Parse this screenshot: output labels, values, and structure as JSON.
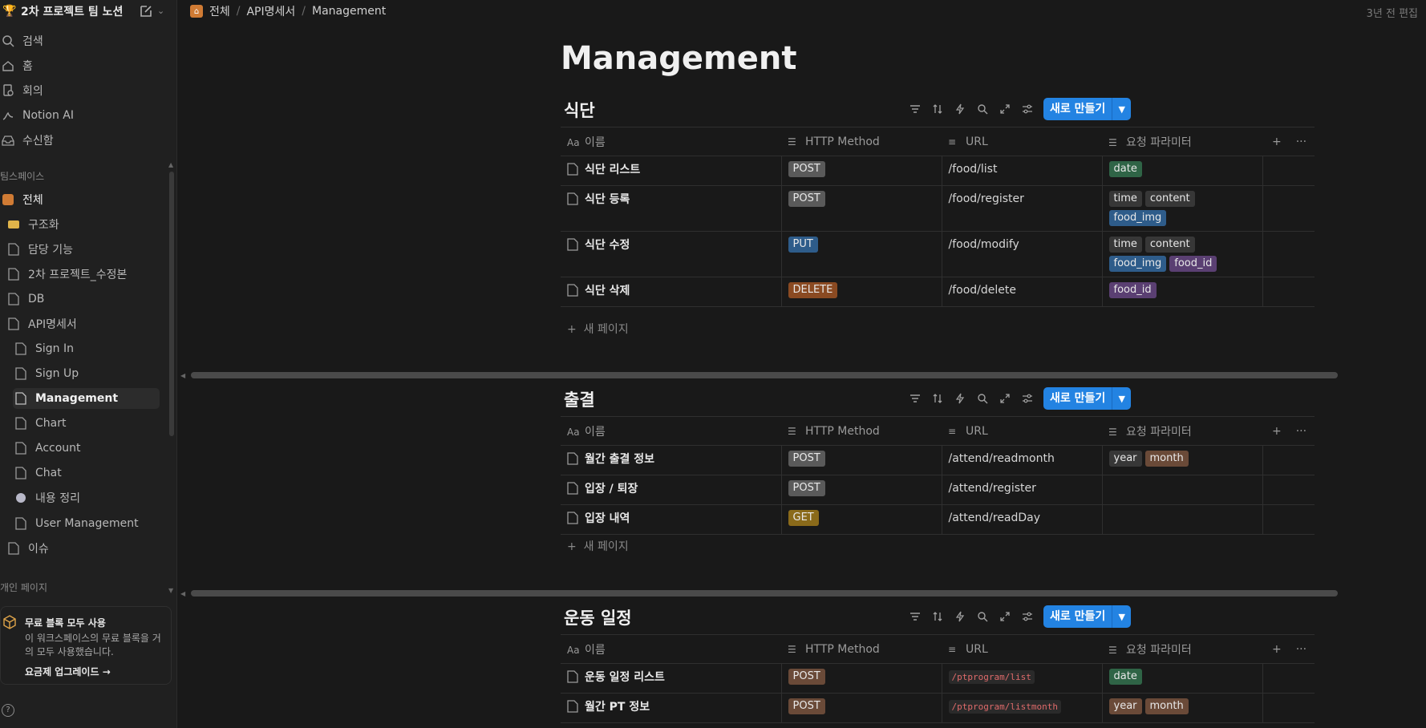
{
  "workspace": {
    "name": "2차 프로젝트 팀 노션"
  },
  "nav": {
    "top": [
      "검색",
      "홈",
      "회의",
      "Notion AI",
      "수신함"
    ],
    "teamspace_label": "팀스페이스",
    "team_root": "전체",
    "pages": [
      "구조화",
      "담당 기능",
      "2차 프로젝트_수정본",
      "DB",
      "API명세서"
    ],
    "api_children": [
      "Sign In",
      "Sign Up",
      "Management",
      "Chart",
      "Account",
      "Chat"
    ],
    "after": [
      "내용 정리",
      "User Management"
    ],
    "issue": "이슈",
    "personal_label": "개인 페이지"
  },
  "upgrade": {
    "title": "무료 블록 모두 사용",
    "desc": "이 워크스페이스의 무료 블록을 거의 모두 사용했습니다.",
    "link": "요금제 업그레이드"
  },
  "breadcrumb": {
    "root": "전체",
    "parent": "API명세서",
    "current": "Management"
  },
  "edited": "3년 전 편집",
  "page": {
    "title": "Management"
  },
  "columns": {
    "name": "이름",
    "method": "HTTP Method",
    "url": "URL",
    "params": "요청 파라미터"
  },
  "new_button": "새로 만들기",
  "new_page": "새 페이지",
  "databases": [
    {
      "title": "식단",
      "rows": [
        {
          "name": "식단 리스트",
          "method": "POST",
          "method_color": "gray",
          "url": "/food/list",
          "url_code": false,
          "params": [
            {
              "t": "date",
              "c": "green"
            }
          ]
        },
        {
          "name": "식단 등록",
          "method": "POST",
          "method_color": "gray",
          "url": "/food/register",
          "url_code": false,
          "params": [
            {
              "t": "time",
              "c": "dark"
            },
            {
              "t": "content",
              "c": "dark"
            },
            {
              "t": "food_img",
              "c": "blue"
            }
          ]
        },
        {
          "name": "식단 수정",
          "method": "PUT",
          "method_color": "blue",
          "url": "/food/modify",
          "url_code": false,
          "params": [
            {
              "t": "time",
              "c": "dark"
            },
            {
              "t": "content",
              "c": "dark"
            },
            {
              "t": "food_img",
              "c": "blue"
            },
            {
              "t": "food_id",
              "c": "purple"
            }
          ]
        },
        {
          "name": "식단 삭제",
          "method": "DELETE",
          "method_color": "orange",
          "url": "/food/delete",
          "url_code": false,
          "params": [
            {
              "t": "food_id",
              "c": "purple"
            }
          ]
        }
      ]
    },
    {
      "title": "출결",
      "rows": [
        {
          "name": "월간 출결 정보",
          "method": "POST",
          "method_color": "gray",
          "url": "/attend/readmonth",
          "url_code": false,
          "params": [
            {
              "t": "year",
              "c": "dark"
            },
            {
              "t": "month",
              "c": "brown"
            }
          ]
        },
        {
          "name": "입장 / 퇴장",
          "method": "POST",
          "method_color": "gray",
          "url": "/attend/register",
          "url_code": false,
          "params": []
        },
        {
          "name": "입장 내역",
          "method": "GET",
          "method_color": "yellow",
          "url": "/attend/readDay",
          "url_code": false,
          "params": []
        }
      ]
    },
    {
      "title": "운동 일정",
      "rows": [
        {
          "name": "운동 일정 리스트",
          "method": "POST",
          "method_color": "brown",
          "url": "/ptprogram/list",
          "url_code": true,
          "params": [
            {
              "t": "date",
              "c": "green"
            }
          ]
        },
        {
          "name": "월간 PT 정보",
          "method": "POST",
          "method_color": "brown",
          "url": "/ptprogram/listmonth",
          "url_code": true,
          "params": [
            {
              "t": "year",
              "c": "brown"
            },
            {
              "t": "month",
              "c": "brown"
            }
          ]
        }
      ]
    }
  ]
}
